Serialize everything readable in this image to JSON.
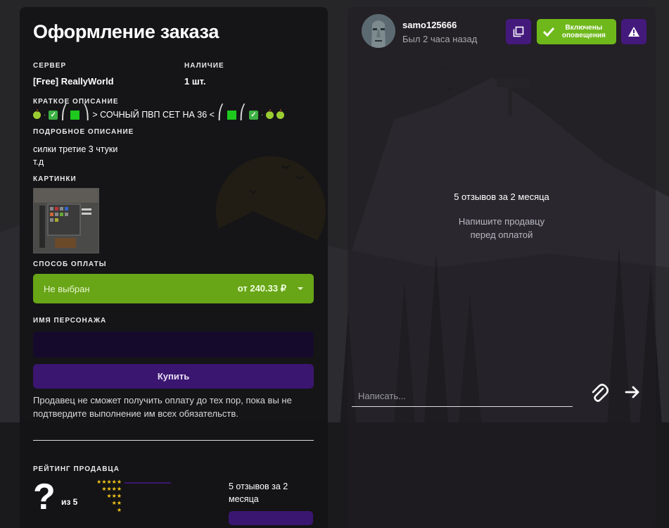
{
  "order": {
    "title": "Оформление заказа",
    "server_label": "СЕРВЕР",
    "server_value": "[Free] ReallyWorld",
    "stock_label": "НАЛИЧИЕ",
    "stock_value": "1 шт.",
    "short_desc_label": "КРАТКОЕ ОПИСАНИЕ",
    "short_desc_text": "> СОЧНЫЙ ПВП СЕТ НА 36 <",
    "full_desc_label": "ПОДРОБНОЕ ОПИСАНИЕ",
    "full_desc_line1": "силки третие 3 чтуки",
    "full_desc_line2": "т.д",
    "pictures_label": "КАРТИНКИ",
    "payment_label": "СПОСОБ ОПЛАТЫ",
    "payment_selected": "Не выбран",
    "payment_price": "от 240.33 ₽",
    "character_label": "ИМЯ ПЕРСОНАЖА",
    "character_value": "",
    "buy_label": "Купить",
    "notice": "Продавец не сможет получить оплату до тех пор, пока вы не подтвердите выполнение им всех обязательств.",
    "rating_label": "РЕЙТИНГ ПРОДАВЦА",
    "rating_value": "?",
    "rating_of": "из 5",
    "reviews_small": "5 отзывов за 2 месяца"
  },
  "seller": {
    "username": "samo125666",
    "last_seen": "Был 2 часа назад",
    "notifications_line1": "Включены",
    "notifications_line2": "оповещения",
    "reviews": "5 отзывов за 2 месяца",
    "hint_line1": "Напишите продавцу",
    "hint_line2": "перед оплатой",
    "message_placeholder": "Написать..."
  },
  "icons": {
    "copy": "copy-icon",
    "check": "check-icon",
    "report": "warning-icon",
    "attach": "paperclip-icon",
    "send": "arrow-right-icon"
  },
  "colors": {
    "accent_purple": "#44197c",
    "accent_green": "#6fb81b",
    "payment_green": "#68a517",
    "star": "#f5c518"
  }
}
